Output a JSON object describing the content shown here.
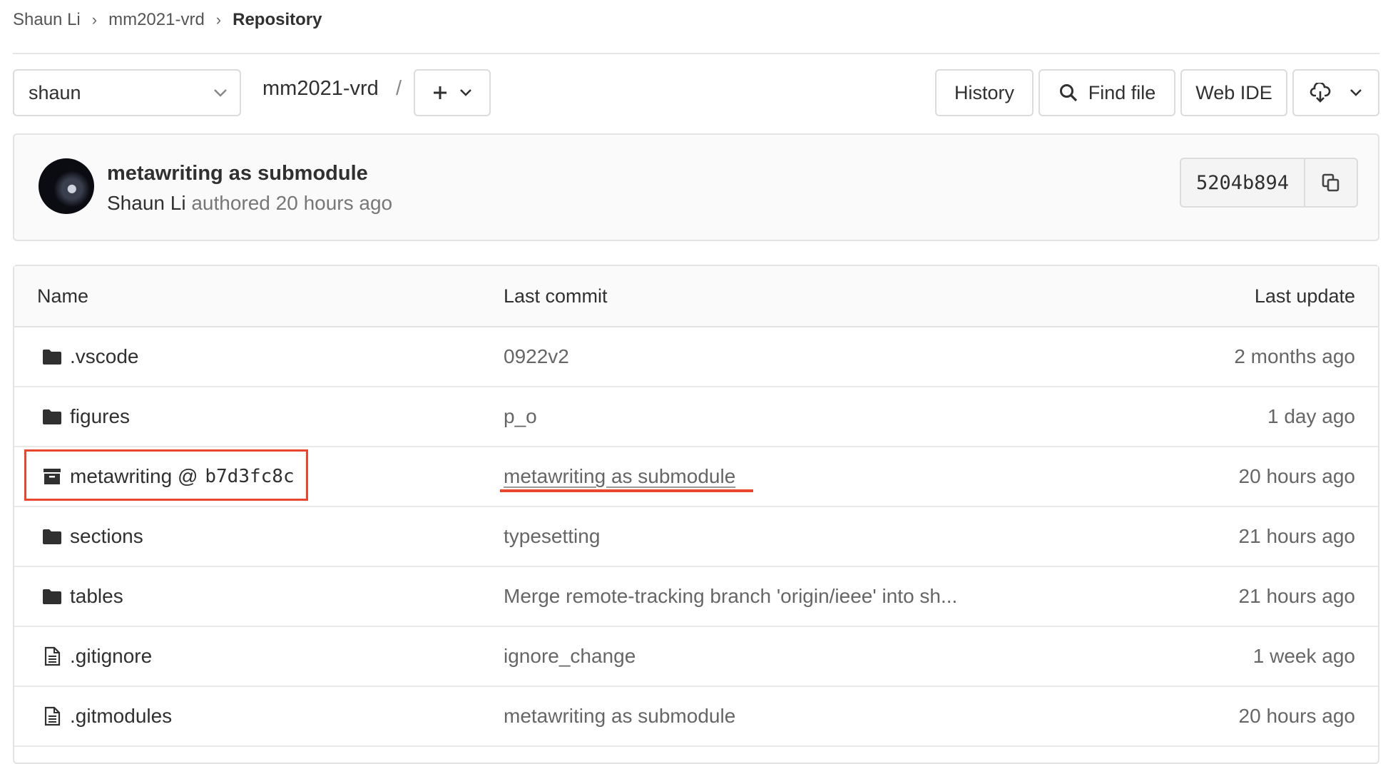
{
  "breadcrumb": {
    "items": [
      "Shaun Li",
      "mm2021-vrd",
      "Repository"
    ],
    "separator": "›"
  },
  "toolbar": {
    "branch": "shaun",
    "project_path": "mm2021-vrd",
    "path_separator": "/",
    "add_icon": "plus-icon",
    "history_label": "History",
    "find_file_label": "Find file",
    "web_ide_label": "Web IDE",
    "clone_icon": "cloud-download-icon"
  },
  "last_commit": {
    "title": "metawriting as submodule",
    "author": "Shaun Li",
    "authored_text": "authored 20 hours ago",
    "sha": "5204b894"
  },
  "tree": {
    "headers": {
      "name": "Name",
      "last_commit": "Last commit",
      "last_update": "Last update"
    },
    "rows": [
      {
        "type": "folder",
        "name": ".vscode",
        "commit": "0922v2",
        "updated": "2 months ago"
      },
      {
        "type": "folder",
        "name": "figures",
        "commit": "p_o",
        "updated": "1 day ago"
      },
      {
        "type": "submodule",
        "name": "metawriting @",
        "sha": "b7d3fc8c",
        "commit": "metawriting as submodule",
        "updated": "20 hours ago"
      },
      {
        "type": "folder",
        "name": "sections",
        "commit": "typesetting",
        "updated": "21 hours ago"
      },
      {
        "type": "folder",
        "name": "tables",
        "commit": "Merge remote-tracking branch 'origin/ieee' into sh...",
        "updated": "21 hours ago"
      },
      {
        "type": "file",
        "name": ".gitignore",
        "commit": "ignore_change",
        "updated": "1 week ago"
      },
      {
        "type": "file",
        "name": ".gitmodules",
        "commit": "metawriting as submodule",
        "updated": "20 hours ago"
      }
    ]
  },
  "colors": {
    "annotation": "#e8462f",
    "border": "#dcdcde",
    "text": "#303030",
    "muted": "#666666"
  }
}
